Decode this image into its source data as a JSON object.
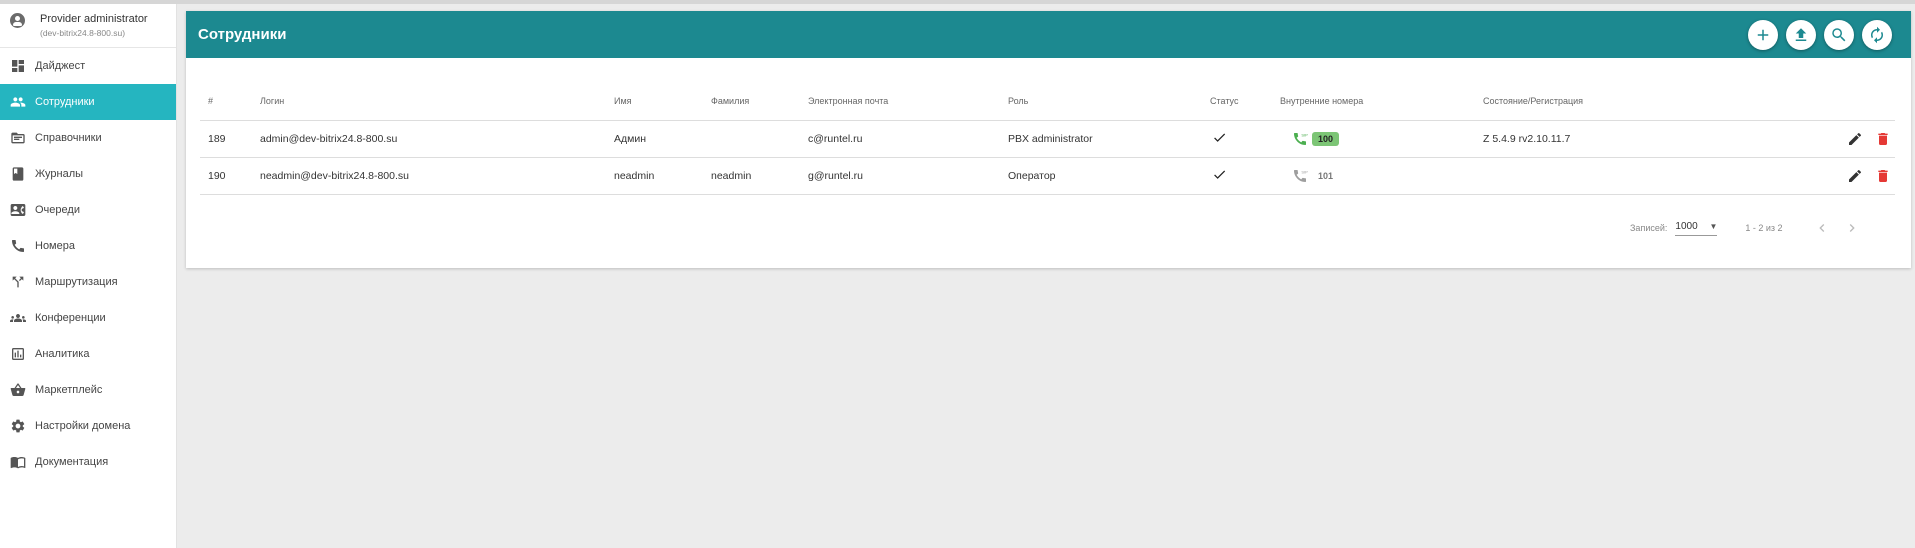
{
  "user": {
    "name": "Provider administrator",
    "domain": "(dev-bitrix24.8-800.su)"
  },
  "sidebar": {
    "items": [
      {
        "label": "Дайджест",
        "icon": "dashboard-icon",
        "active": false
      },
      {
        "label": "Сотрудники",
        "icon": "people-icon",
        "active": true
      },
      {
        "label": "Справочники",
        "icon": "folder-icon",
        "active": false
      },
      {
        "label": "Журналы",
        "icon": "book-icon",
        "active": false
      },
      {
        "label": "Очереди",
        "icon": "contact-card-icon",
        "active": false
      },
      {
        "label": "Номера",
        "icon": "phone-icon",
        "active": false
      },
      {
        "label": "Маршрутизация",
        "icon": "routing-icon",
        "active": false
      },
      {
        "label": "Конференции",
        "icon": "groups-icon",
        "active": false
      },
      {
        "label": "Аналитика",
        "icon": "analytics-icon",
        "active": false
      },
      {
        "label": "Маркетплейс",
        "icon": "basket-icon",
        "active": false
      },
      {
        "label": "Настройки домена",
        "icon": "gear-icon",
        "active": false
      },
      {
        "label": "Документация",
        "icon": "docs-icon",
        "active": false
      }
    ]
  },
  "page": {
    "title": "Сотрудники",
    "actions": [
      "add-icon",
      "upload-icon",
      "search-icon",
      "refresh-icon"
    ]
  },
  "table": {
    "columns": [
      "#",
      "Логин",
      "Имя",
      "Фамилия",
      "Электронная почта",
      "Роль",
      "Статус",
      "Внутренние номера",
      "Состояние/Регистрация"
    ],
    "rows": [
      {
        "id": "189",
        "login": "admin@dev-bitrix24.8-800.su",
        "first_name": "Админ",
        "last_name": "",
        "email": "c@runtel.ru",
        "role": "PBX administrator",
        "status": "check-icon",
        "extension": "100",
        "extension_online": true,
        "registration": "Z 5.4.9 rv2.10.11.7"
      },
      {
        "id": "190",
        "login": "neadmin@dev-bitrix24.8-800.su",
        "first_name": "neadmin",
        "last_name": "neadmin",
        "email": "g@runtel.ru",
        "role": "Оператор",
        "status": "check-icon",
        "extension": "101",
        "extension_online": false,
        "registration": ""
      }
    ]
  },
  "pagination": {
    "rows_label": "Записей:",
    "rows_value": "1000",
    "range": "1 - 2 из 2"
  },
  "colors": {
    "header": "#1c8990",
    "active_nav": "#25b5c0",
    "online_badge": "#7cc575",
    "delete": "#e53935",
    "sip_online": "#4caf50",
    "sip_offline": "#9e9e9e"
  }
}
